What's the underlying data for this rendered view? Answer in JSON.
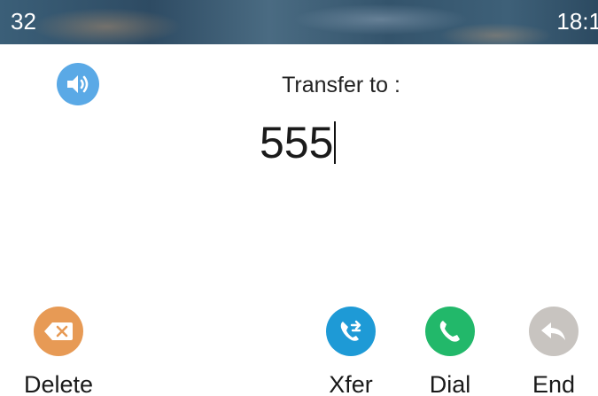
{
  "status_bar": {
    "left_text": "32",
    "time": "18:1"
  },
  "call": {
    "title": "Transfer to :",
    "number": "555"
  },
  "softkeys": [
    {
      "label": "Delete",
      "icon": "backspace-icon",
      "color": "#e79a55"
    },
    {
      "label": "Xfer",
      "icon": "transfer-icon",
      "color": "#1e9ad6"
    },
    {
      "label": "Dial",
      "icon": "phone-icon",
      "color": "#22b86a"
    },
    {
      "label": "End",
      "icon": "end-call-icon",
      "color": "#c8c4c0"
    }
  ],
  "speaker": {
    "icon": "speaker-icon",
    "color": "#5aa9e6"
  }
}
